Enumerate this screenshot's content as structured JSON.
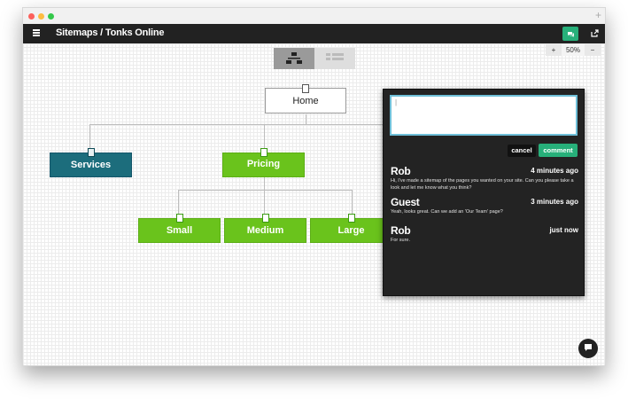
{
  "app": {
    "title": "Sitemaps / Tonks Online"
  },
  "colors": {
    "accent": "#27b07a",
    "node_green": "#6ac31c",
    "node_teal": "#1c6d7c",
    "topbar": "#222222"
  },
  "toolbar": {
    "menu_icon": "hamburger-icon",
    "comments_icon": "chat-bubble-icon",
    "share_icon": "share-icon"
  },
  "zoom": {
    "minus": "−",
    "value": "50%",
    "plus": "+"
  },
  "sitemap": {
    "root": "Home",
    "nodes": [
      {
        "label": "Services"
      },
      {
        "label": "Pricing"
      },
      {
        "label": "Small"
      },
      {
        "label": "Medium"
      },
      {
        "label": "Large"
      }
    ]
  },
  "comments_panel": {
    "input_value": "|",
    "cancel_label": "cancel",
    "comment_label": "comment",
    "comments": [
      {
        "author": "Rob",
        "time": "4 minutes ago",
        "text": "Hi, I've made a sitemap of the pages you wanted on your site. Can you please take a look and let me know what you think?"
      },
      {
        "author": "Guest",
        "time": "3 minutes ago",
        "text": "Yeah, looks great. Can we add an 'Our Team' page?"
      },
      {
        "author": "Rob",
        "time": "just now",
        "text": "For sure."
      }
    ]
  },
  "help": {
    "icon": "chat-help-icon"
  }
}
